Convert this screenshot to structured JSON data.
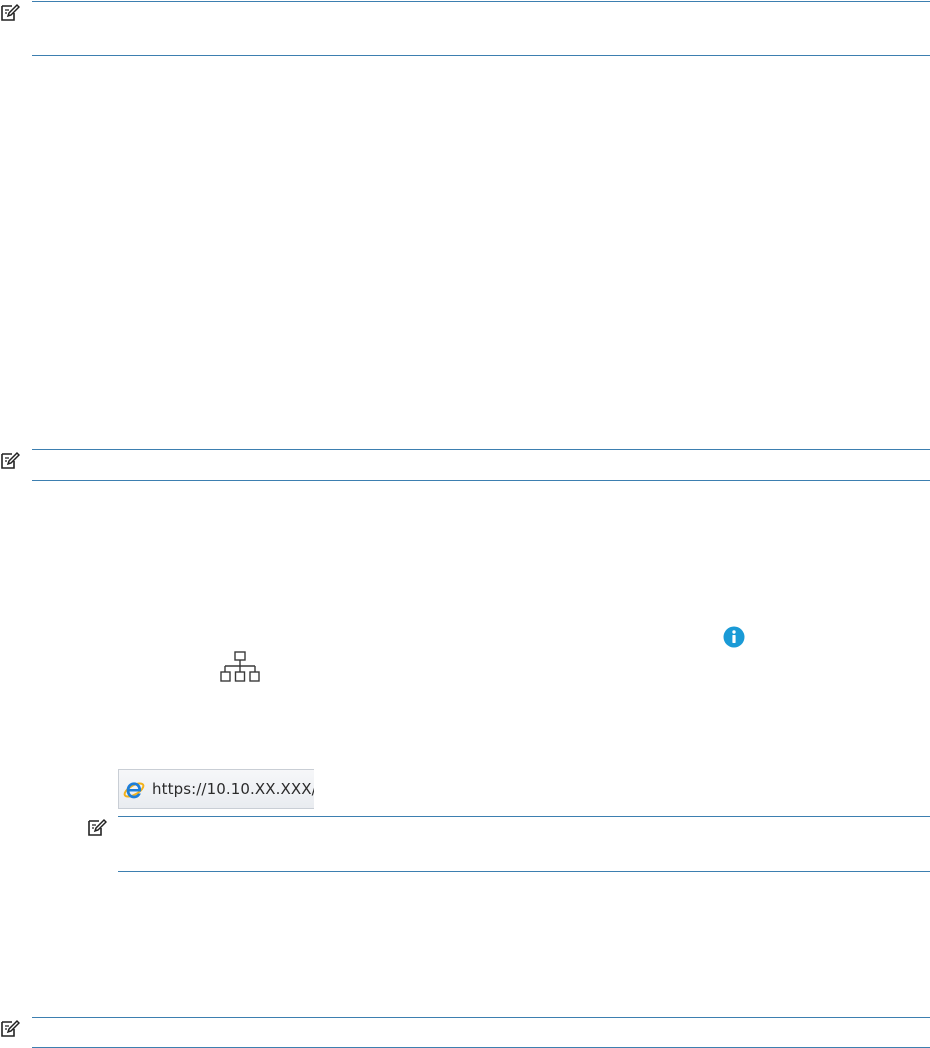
{
  "notes": [
    {
      "id": "note-1",
      "icon": "note-pencil-icon"
    },
    {
      "id": "note-2",
      "icon": "note-pencil-icon"
    },
    {
      "id": "note-3",
      "icon": "note-pencil-icon"
    },
    {
      "id": "note-4",
      "icon": "note-pencil-icon"
    }
  ],
  "icons": {
    "info": {
      "name": "info-icon",
      "glyph": "i",
      "color": "#1a9ad6"
    },
    "network": {
      "name": "network-icon",
      "color": "#3a3a3a"
    }
  },
  "address_bar": {
    "icon": "internet-explorer-icon",
    "url": "https://10.10.XX.XXX/"
  },
  "colors": {
    "rule": "#3d7fb0",
    "info_blue": "#1a9ad6"
  }
}
